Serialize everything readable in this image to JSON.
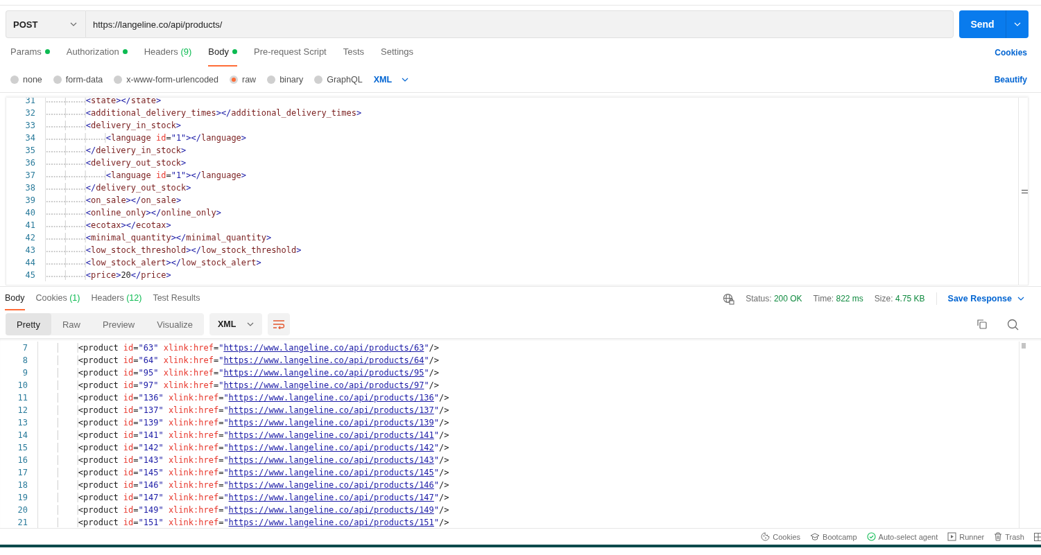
{
  "request": {
    "method": "POST",
    "url": "https://langeline.co/api/products/",
    "send_label": "Send"
  },
  "request_tabs": [
    {
      "label": "Params",
      "dot": true,
      "selected": false
    },
    {
      "label": "Authorization",
      "dot": true,
      "selected": false
    },
    {
      "label": "Headers",
      "count": "(9)",
      "dot": false,
      "selected": false
    },
    {
      "label": "Body",
      "dot": true,
      "selected": true
    },
    {
      "label": "Pre-request Script",
      "dot": false,
      "selected": false
    },
    {
      "label": "Tests",
      "dot": false,
      "selected": false
    },
    {
      "label": "Settings",
      "dot": false,
      "selected": false
    }
  ],
  "cookies_link": "Cookies",
  "body_types": [
    {
      "label": "none",
      "selected": false
    },
    {
      "label": "form-data",
      "selected": false
    },
    {
      "label": "x-www-form-urlencoded",
      "selected": false
    },
    {
      "label": "raw",
      "selected": true
    },
    {
      "label": "binary",
      "selected": false
    },
    {
      "label": "GraphQL",
      "selected": false
    }
  ],
  "body_format": "XML",
  "beautify": "Beautify",
  "request_body": {
    "lines": [
      {
        "number": "31",
        "text": "        <state></state>"
      },
      {
        "number": "32",
        "text": "        <additional_delivery_times></additional_delivery_times>"
      },
      {
        "number": "33",
        "text": "        <delivery_in_stock>"
      },
      {
        "number": "34",
        "text": "            <language id=\"1\"></language>"
      },
      {
        "number": "35",
        "text": "        </delivery_in_stock>"
      },
      {
        "number": "36",
        "text": "        <delivery_out_stock>"
      },
      {
        "number": "37",
        "text": "            <language id=\"1\"></language>"
      },
      {
        "number": "38",
        "text": "        </delivery_out_stock>"
      },
      {
        "number": "39",
        "text": "        <on_sale></on_sale>"
      },
      {
        "number": "40",
        "text": "        <online_only></online_only>"
      },
      {
        "number": "41",
        "text": "        <ecotax></ecotax>"
      },
      {
        "number": "42",
        "text": "        <minimal_quantity></minimal_quantity>"
      },
      {
        "number": "43",
        "text": "        <low_stock_threshold></low_stock_threshold>"
      },
      {
        "number": "44",
        "text": "        <low_stock_alert></low_stock_alert>"
      },
      {
        "number": "45",
        "text": "        <price>20</price>"
      }
    ]
  },
  "response": {
    "tabs": [
      {
        "label": "Body",
        "selected": true
      },
      {
        "label": "Cookies",
        "count": "(1)",
        "selected": false
      },
      {
        "label": "Headers",
        "count": "(12)",
        "selected": false
      },
      {
        "label": "Test Results",
        "selected": false
      }
    ],
    "status_label": "Status:",
    "status": "200 OK",
    "time_label": "Time:",
    "time": "822 ms",
    "size_label": "Size:",
    "size": "4.75 KB",
    "save_label": "Save Response",
    "view_modes": [
      {
        "label": "Pretty",
        "selected": true
      },
      {
        "label": "Raw",
        "selected": false
      },
      {
        "label": "Preview",
        "selected": false
      },
      {
        "label": "Visualize",
        "selected": false
      }
    ],
    "format": "XML",
    "lines": [
      {
        "number": "7",
        "text": "        <product id=\"63\" xlink:href=\"https://www.langeline.co/api/products/63\"/>"
      },
      {
        "number": "8",
        "text": "        <product id=\"64\" xlink:href=\"https://www.langeline.co/api/products/64\"/>"
      },
      {
        "number": "9",
        "text": "        <product id=\"95\" xlink:href=\"https://www.langeline.co/api/products/95\"/>"
      },
      {
        "number": "10",
        "text": "        <product id=\"97\" xlink:href=\"https://www.langeline.co/api/products/97\"/>"
      },
      {
        "number": "11",
        "text": "        <product id=\"136\" xlink:href=\"https://www.langeline.co/api/products/136\"/>"
      },
      {
        "number": "12",
        "text": "        <product id=\"137\" xlink:href=\"https://www.langeline.co/api/products/137\"/>"
      },
      {
        "number": "13",
        "text": "        <product id=\"139\" xlink:href=\"https://www.langeline.co/api/products/139\"/>"
      },
      {
        "number": "14",
        "text": "        <product id=\"141\" xlink:href=\"https://www.langeline.co/api/products/141\"/>"
      },
      {
        "number": "15",
        "text": "        <product id=\"142\" xlink:href=\"https://www.langeline.co/api/products/142\"/>"
      },
      {
        "number": "16",
        "text": "        <product id=\"143\" xlink:href=\"https://www.langeline.co/api/products/143\"/>"
      },
      {
        "number": "17",
        "text": "        <product id=\"145\" xlink:href=\"https://www.langeline.co/api/products/145\"/>"
      },
      {
        "number": "18",
        "text": "        <product id=\"146\" xlink:href=\"https://www.langeline.co/api/products/146\"/>"
      },
      {
        "number": "19",
        "text": "        <product id=\"147\" xlink:href=\"https://www.langeline.co/api/products/147\"/>"
      },
      {
        "number": "20",
        "text": "        <product id=\"149\" xlink:href=\"https://www.langeline.co/api/products/149\"/>"
      },
      {
        "number": "21",
        "text": "        <product id=\"151\" xlink:href=\"https://www.langeline.co/api/products/151\"/>"
      }
    ]
  },
  "footer": [
    {
      "kind": "cookie",
      "label": "Cookies"
    },
    {
      "kind": "bootcamp",
      "label": "Bootcamp"
    },
    {
      "kind": "agent",
      "label": "Auto-select agent"
    },
    {
      "kind": "runner",
      "label": "Runner"
    },
    {
      "kind": "trash",
      "label": "Trash"
    }
  ]
}
